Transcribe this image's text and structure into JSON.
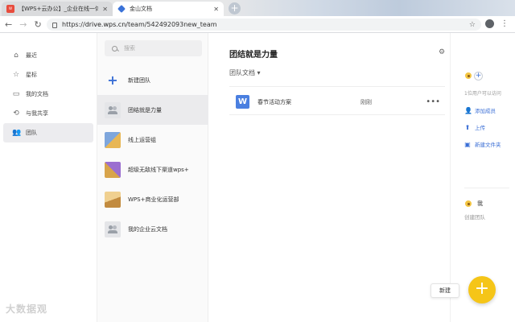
{
  "browser": {
    "tabs": [
      {
        "title": "【WPS+云办公】_企业在线一体",
        "favicon": "wps-icon",
        "active": false
      },
      {
        "title": "金山文档",
        "favicon": "docs-icon",
        "active": true
      }
    ],
    "url_scheme": "https://",
    "url_host": "drive.wps.cn",
    "url_path": "/team/542492093new_team"
  },
  "sidebar": {
    "items": [
      {
        "label": "最近",
        "icon": "home-icon",
        "glyph": "⌂"
      },
      {
        "label": "星标",
        "icon": "star-icon",
        "glyph": "☆"
      },
      {
        "label": "我的文档",
        "icon": "folder-icon",
        "glyph": "▭"
      },
      {
        "label": "与我共享",
        "icon": "share-icon",
        "glyph": "⟲"
      },
      {
        "label": "团队",
        "icon": "team-icon",
        "glyph": "👥"
      }
    ],
    "active_index": 4
  },
  "teams": {
    "search_placeholder": "搜索",
    "new_team_label": "新建团队",
    "items": [
      {
        "name": "团结就是力量",
        "icon": "people"
      },
      {
        "name": "线上运营组",
        "icon": "mosaic"
      },
      {
        "name": "超级无敌线下渠道wps+",
        "icon": "mosaic b"
      },
      {
        "name": "WPS+商业化运营部",
        "icon": "mosaic c"
      },
      {
        "name": "我的企业云文档",
        "icon": "people"
      }
    ]
  },
  "main": {
    "title": "团结就是力量",
    "subtitle": "团队文档 ▾",
    "files": [
      {
        "name": "春节活动方案",
        "owner": "刚刚",
        "icon_glyph": "W",
        "more": "•••"
      }
    ]
  },
  "panel": {
    "member_note": "1位用户可以访问",
    "actions": [
      {
        "label": "添加成员",
        "icon": "add-user-icon",
        "glyph": "👤"
      },
      {
        "label": "上传",
        "icon": "upload-icon",
        "glyph": "⬆"
      },
      {
        "label": "新建文件夹",
        "icon": "new-folder-icon",
        "glyph": "▣"
      }
    ],
    "owner_name": "我",
    "owner_note": "创建团队"
  },
  "fab": {
    "new_label": "新建",
    "glyph": "+"
  },
  "watermark": "大数据观",
  "colors": {
    "accent": "#3b6fd6",
    "fab": "#f5c518",
    "wps_red": "#e84c3d"
  }
}
